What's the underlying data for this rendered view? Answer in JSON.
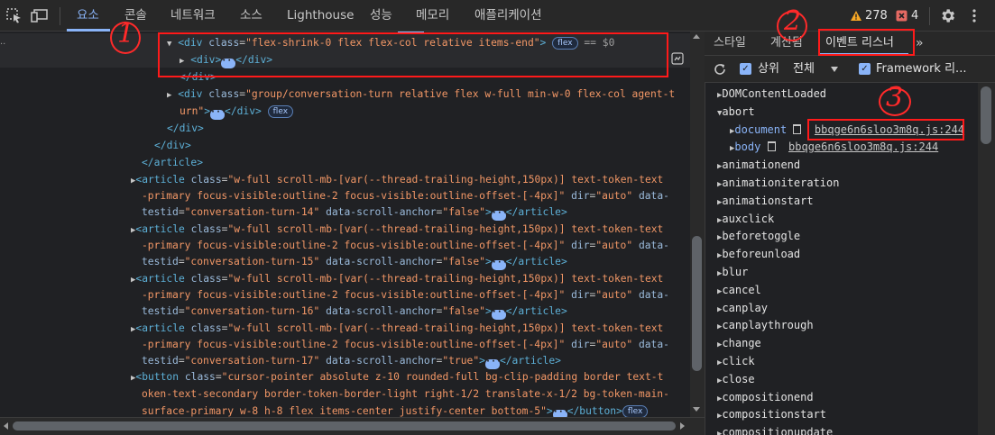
{
  "toolbar": {
    "tabs": [
      "요소",
      "콘솔",
      "네트워크",
      "소스",
      "Lighthouse",
      "성능",
      "메모리",
      "애플리케이션"
    ],
    "warnings": "278",
    "errors": "4"
  },
  "elements": {
    "line1": {
      "tag": "div",
      "attr": "class",
      "value": "\"flex-shrink-0 flex flex-col relative items-end\"",
      "pill": "flex",
      "marker": "== $0"
    },
    "line2": {
      "open": "<div>",
      "close": "</div>"
    },
    "line3": "</div>",
    "line4": {
      "attr": "class",
      "value": "\"group/conversation-turn relative flex w-full min-w-0 flex-col agent-t",
      "cont": "urn\"",
      "close": "</div>",
      "pill": "flex"
    },
    "line5": "</div>",
    "line6": "</div>",
    "line7": "</article>",
    "articles": [
      {
        "a": "\"w-full scroll-mb-[var(--thread-trailing-height,150px)] text-token-text",
        "b": "-primary focus-visible:outline-2 focus-visible:outline-offset-[-4px]\"",
        "dir": "\"auto\"",
        "c": "testid",
        "tid": "\"conversation-turn-14\"",
        "anchor": "\"false\""
      },
      {
        "a": "\"w-full scroll-mb-[var(--thread-trailing-height,150px)] text-token-text",
        "b": "-primary focus-visible:outline-2 focus-visible:outline-offset-[-4px]\"",
        "dir": "\"auto\"",
        "c": "testid",
        "tid": "\"conversation-turn-15\"",
        "anchor": "\"false\""
      },
      {
        "a": "\"w-full scroll-mb-[var(--thread-trailing-height,150px)] text-token-text",
        "b": "-primary focus-visible:outline-2 focus-visible:outline-offset-[-4px]\"",
        "dir": "\"auto\"",
        "c": "testid",
        "tid": "\"conversation-turn-16\"",
        "anchor": "\"false\""
      },
      {
        "a": "\"w-full scroll-mb-[var(--thread-trailing-height,150px)] text-token-text",
        "b": "-primary focus-visible:outline-2 focus-visible:outline-offset-[-4px]\"",
        "dir": "\"auto\"",
        "c": "testid",
        "tid": "\"conversation-turn-17\"",
        "anchor": "\"true\""
      }
    ],
    "button": {
      "a": "\"cursor-pointer absolute z-10 rounded-full bg-clip-padding border text-t",
      "b": "oken-text-secondary border-token-border-light right-1/2 translate-x-1/2 bg-token-main-",
      "c": "surface-primary w-8 h-8 flex items-center justify-center bottom-5\"",
      "close": "</button>",
      "pill": "flex"
    }
  },
  "right_panel": {
    "tabs": [
      "스타일",
      "계산됨",
      "이벤트 리스너"
    ],
    "ancestors_label": "상위",
    "filter_value": "전체",
    "framework_label": "Framework 리...",
    "events": [
      "DOMContentLoaded",
      "abort",
      "animationend",
      "animationiteration",
      "animationstart",
      "auxclick",
      "beforetoggle",
      "beforeunload",
      "blur",
      "cancel",
      "canplay",
      "canplaythrough",
      "change",
      "click",
      "close",
      "compositionend",
      "compositionstart",
      "compositionupdate"
    ],
    "abort_children": [
      {
        "node": "document",
        "link": "bbqge6n6sloo3m8q.js:244"
      },
      {
        "node": "body",
        "link": "bbqge6n6sloo3m8q.js:244"
      }
    ]
  },
  "annotations": [
    "1",
    "2",
    "3"
  ]
}
